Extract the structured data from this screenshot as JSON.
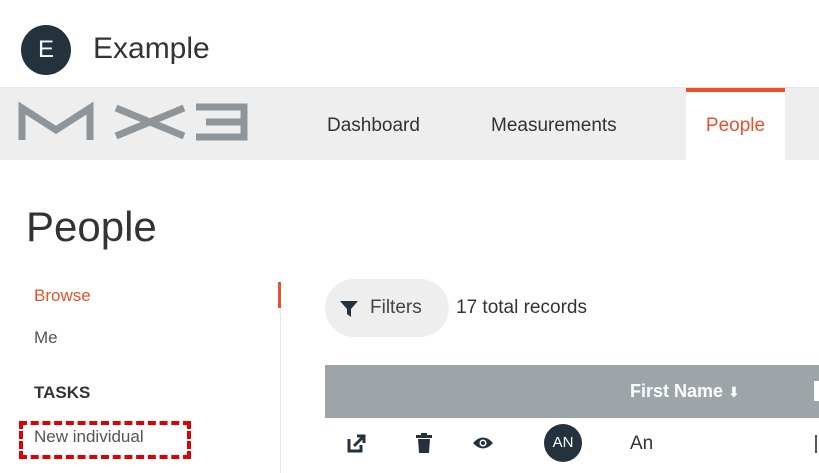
{
  "app": {
    "org_avatar_letter": "E",
    "org_name": "Example",
    "logo_text": "MX3"
  },
  "nav": {
    "tabs": [
      {
        "label": "Dashboard",
        "active": false
      },
      {
        "label": "Measurements",
        "active": false
      },
      {
        "label": "People",
        "active": true
      }
    ]
  },
  "page": {
    "title": "People"
  },
  "sidebar": {
    "links": [
      {
        "label": "Browse",
        "active": true
      },
      {
        "label": "Me",
        "active": false
      }
    ],
    "tasks_heading": "TASKS",
    "tasks": [
      {
        "label": "New individual",
        "highlighted": true
      }
    ]
  },
  "toolbar": {
    "filters_label": "Filters",
    "records_count": "17 total records"
  },
  "table": {
    "columns": [
      {
        "label": "First Name",
        "sort": "descending"
      }
    ],
    "sort_glyph": "⬇",
    "rows": [
      {
        "avatar_initials": "AN",
        "first_name": "An",
        "actions": [
          "open-external-icon",
          "trash-icon",
          "eye-icon"
        ]
      }
    ]
  },
  "colors": {
    "accent": "#e8512b",
    "avatar_bg": "#24323e",
    "table_header_bg": "#9ea5a9",
    "nav_bg": "#eeeeee",
    "highlight": "#e00000"
  }
}
